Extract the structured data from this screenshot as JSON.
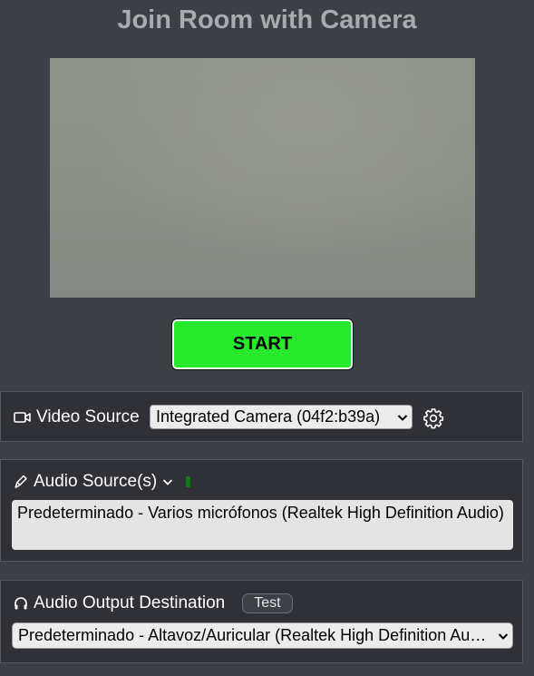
{
  "header": {
    "title": "Join Room with Camera"
  },
  "camera_preview": {
    "name": "camera-preview"
  },
  "start_button": {
    "label": "START",
    "color": "#27ea2c"
  },
  "video": {
    "label": "Video Source",
    "selected": "Integrated Camera (04f2:b39a)",
    "icon": "video-camera-icon",
    "settings_icon": "gear-icon"
  },
  "audio": {
    "label": "Audio Source(s)",
    "icon": "microphone-icon",
    "expand_icon": "chevron-down-icon",
    "level_color": "#0f7a12",
    "selected": "Predeterminado - Varios micrófonos (Realtek High Definition Audio)"
  },
  "output": {
    "label": "Audio Output Destination",
    "icon": "headphones-icon",
    "test_label": "Test",
    "selected": "Predeterminado - Altavoz/Auricular (Realtek High Definition Audio)"
  }
}
